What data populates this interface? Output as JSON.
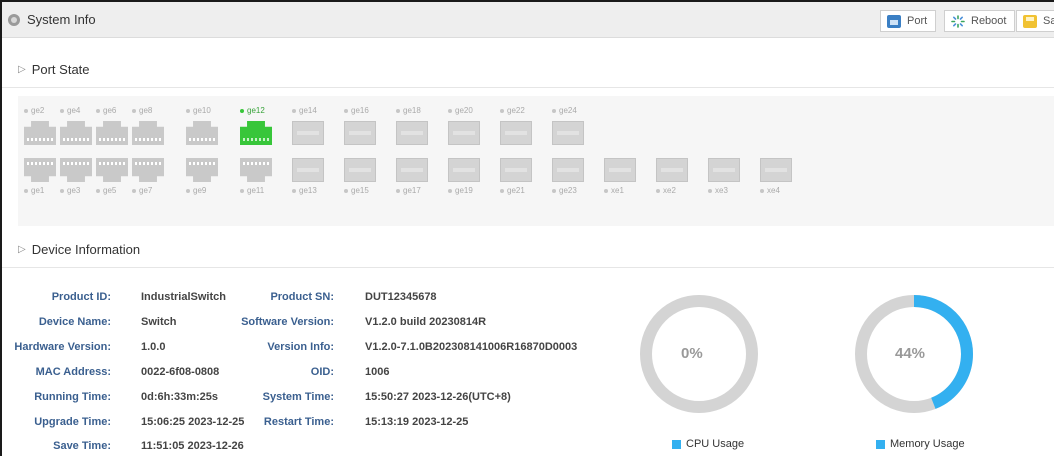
{
  "header": {
    "title": "System Info",
    "buttons": [
      {
        "label": "Port",
        "icon": "port-icon"
      },
      {
        "label": "Reboot",
        "icon": "reboot-icon"
      },
      {
        "label": "Sav",
        "icon": "save-icon"
      }
    ]
  },
  "sections": {
    "port_state": "Port State",
    "device_info": "Device Information"
  },
  "ports": {
    "top_row": [
      "ge2",
      "ge4",
      "ge6",
      "ge8",
      "ge10",
      "ge12",
      "ge14",
      "ge16",
      "ge18",
      "ge20",
      "ge22",
      "ge24"
    ],
    "bottom_row": [
      "ge1",
      "ge3",
      "ge5",
      "ge7",
      "ge9",
      "ge11",
      "ge13",
      "ge15",
      "ge17",
      "ge19",
      "ge21",
      "ge23",
      "xe1",
      "xe2",
      "xe3",
      "xe4"
    ],
    "link_up": [
      "ge12"
    ],
    "colors": {
      "up": "#38c63a",
      "down": "#c9c9c9"
    }
  },
  "device": {
    "left": [
      {
        "label": "Product ID:",
        "value": "IndustrialSwitch"
      },
      {
        "label": "Device Name:",
        "value": "Switch"
      },
      {
        "label": "Hardware Version:",
        "value": "1.0.0"
      },
      {
        "label": "MAC Address:",
        "value": "0022-6f08-0808"
      },
      {
        "label": "Running Time:",
        "value": "0d:6h:33m:25s"
      },
      {
        "label": "Upgrade Time:",
        "value": "15:06:25 2023-12-25"
      },
      {
        "label": "Save Time:",
        "value": "11:51:05 2023-12-26"
      }
    ],
    "right": [
      {
        "label": "Product SN:",
        "value": "DUT12345678"
      },
      {
        "label": "Software Version:",
        "value": "V1.2.0 build 20230814R"
      },
      {
        "label": "Version Info:",
        "value": "V1.2.0-7.1.0B202308141006R16870D0003"
      },
      {
        "label": "OID:",
        "value": "1006"
      },
      {
        "label": "System Time:",
        "value": "15:50:27 2023-12-26(UTC+8)"
      },
      {
        "label": "Restart Time:",
        "value": "15:13:19 2023-12-25"
      }
    ]
  },
  "usage": {
    "cpu": {
      "text": "0%",
      "value": 0,
      "legend": "CPU Usage"
    },
    "memory": {
      "text": "44%",
      "value": 44,
      "legend": "Memory Usage"
    },
    "colors": {
      "fill": "#33b0f0",
      "track": "#d4d4d4"
    }
  }
}
